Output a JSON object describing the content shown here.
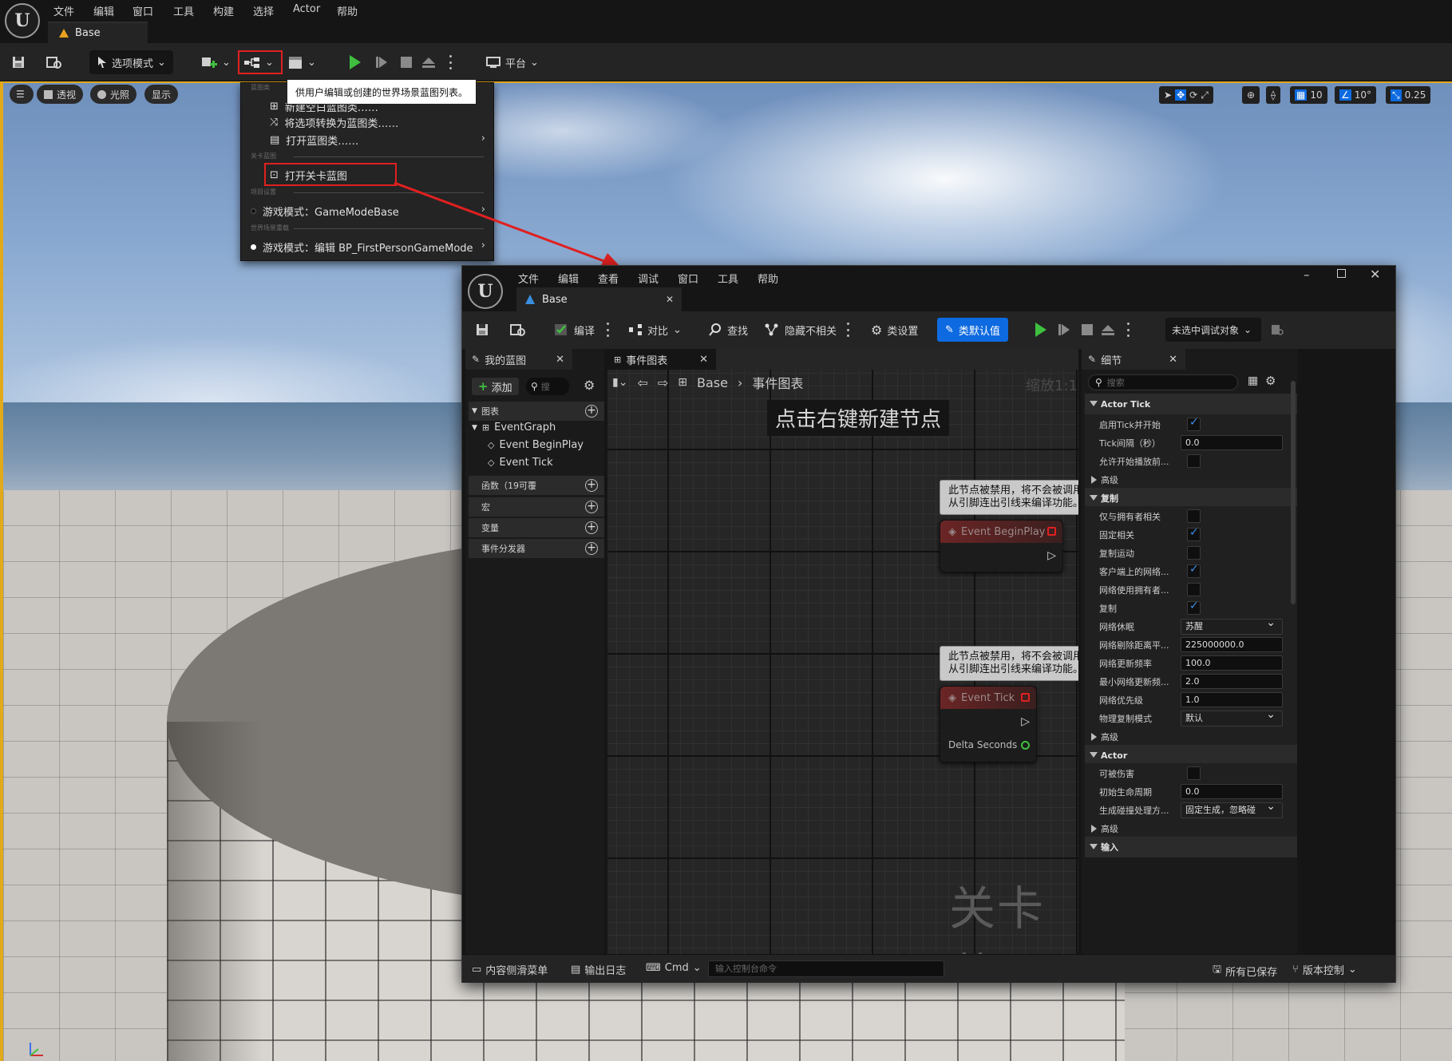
{
  "main_menu": [
    "文件",
    "编辑",
    "窗口",
    "工具",
    "构建",
    "选择",
    "Actor",
    "帮助"
  ],
  "level_tab": "Base",
  "toolbar": {
    "select_mode": "选项模式",
    "platform": "平台"
  },
  "viewport": {
    "perspective": "透视",
    "lit": "光照",
    "show": "显示",
    "grid_snap": "10",
    "rot_snap": "10°",
    "scale_snap": "0.25"
  },
  "tooltip": "供用户编辑或创建的世界场景蓝图列表。",
  "dropdown": {
    "section_blueprint_class": "蓝图类",
    "item_new_class": "新建空白蓝图类……",
    "item_convert": "将选项转换为蓝图类……",
    "item_open_class": "打开蓝图类……",
    "section_level_blueprint": "关卡蓝图",
    "item_open_level_bp": "打开关卡蓝图",
    "section_project_settings": "项目设置",
    "item_gamemode": "游戏模式：GameModeBase",
    "section_world_override": "世界场景重载",
    "item_gamemode_edit": "游戏模式：编辑 BP_FirstPersonGameMode"
  },
  "bp_window": {
    "menu": [
      "文件",
      "编辑",
      "查看",
      "调试",
      "窗口",
      "工具",
      "帮助"
    ],
    "tab_title": "Base",
    "toolbar": {
      "compile": "编译",
      "diff": "对比",
      "find": "查找",
      "hide_unrelated": "隐藏不相关",
      "class_settings": "类设置",
      "class_defaults": "类默认值",
      "debug_object": "未选中调试对象"
    },
    "my_blueprint": {
      "title": "我的蓝图",
      "add": "添加",
      "search_placeholder": "搜",
      "graphs": "图表",
      "event_graph": "EventGraph",
      "event_begin": "Event BeginPlay",
      "event_tick": "Event Tick",
      "functions": "函数（19可覆",
      "macros": "宏",
      "variables": "变量",
      "dispatchers": "事件分发器"
    },
    "graph": {
      "tab": "事件图表",
      "crumb_root": "Base",
      "crumb_leaf": "事件图表",
      "zoom": "缩放1:1",
      "hint": "点击右键新建节点",
      "disabled_note_1": "此节点被禁用，将不会被调用。",
      "disabled_note_2": "从引脚连出引线来编译功能。",
      "node_begin": "Event BeginPlay",
      "node_tick": "Event Tick",
      "pin_delta": "Delta Seconds",
      "watermark": "关卡蓝图"
    },
    "details": {
      "title": "细节",
      "search_placeholder": "搜索",
      "sec_actor_tick": "Actor Tick",
      "start_with_tick": "启用Tick并开始",
      "tick_interval": "Tick间隔（秒）",
      "tick_interval_val": "0.0",
      "allow_tick_before": "允许开始播放前...",
      "advanced": "高级",
      "sec_replication": "复制",
      "only_owner": "仅与拥有者相关",
      "always_relevant": "固定相关",
      "replicate_movement": "复制运动",
      "net_load_client": "客户端上的网络...",
      "net_use_owner": "网络使用拥有者...",
      "replicates": "复制",
      "net_dormancy": "网络休眠",
      "net_dormancy_val": "苏醒",
      "net_cull_dist": "网络剔除距离平...",
      "net_cull_dist_val": "225000000.0",
      "net_update_freq": "网络更新频率",
      "net_update_freq_val": "100.0",
      "min_net_update": "最小网络更新频...",
      "min_net_update_val": "2.0",
      "net_priority": "网络优先级",
      "net_priority_val": "1.0",
      "physics_rep_mode": "物理复制模式",
      "physics_rep_mode_val": "默认",
      "sec_actor": "Actor",
      "can_be_damaged": "可被伤害",
      "initial_lifespan": "初始生命周期",
      "initial_lifespan_val": "0.0",
      "spawn_collision": "生成碰撞处理方...",
      "spawn_collision_val": "固定生成，忽略碰",
      "sec_input": "输入"
    },
    "statusbar": {
      "content_drawer": "内容侧滑菜单",
      "output_log": "输出日志",
      "cmd": "Cmd",
      "console_placeholder": "输入控制台命令",
      "all_saved": "所有已保存",
      "source_control": "版本控制"
    }
  },
  "colors": {
    "accent_blue": "#0d6ae0",
    "play_green": "#3fbf3f",
    "highlight_red": "#e02020",
    "viewport_border": "#e2a91a"
  }
}
